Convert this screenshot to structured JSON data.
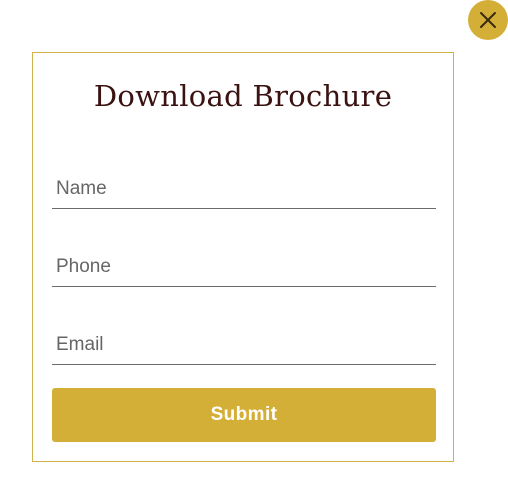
{
  "close_icon": "close-icon",
  "colors": {
    "accent": "#d4af37",
    "title": "#3a1212",
    "border": "#cfb24a"
  },
  "modal": {
    "title": "Download Brochure",
    "fields": {
      "name_placeholder": "Name",
      "phone_placeholder": "Phone",
      "email_placeholder": "Email"
    },
    "submit_label": "Submit"
  }
}
